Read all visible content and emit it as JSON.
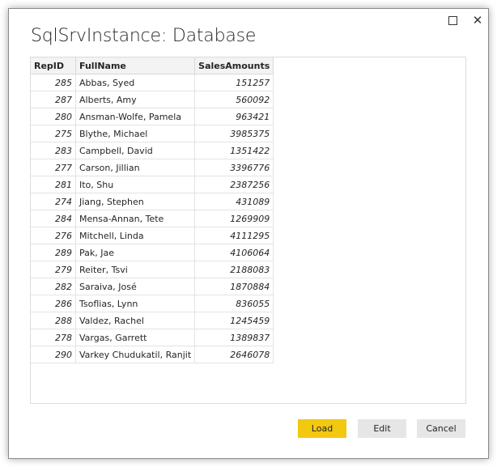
{
  "dialog": {
    "title": "SqlSrvInstance: Database",
    "maximize_icon": "maximize-icon",
    "close_icon": "close-icon",
    "close_glyph": "✕"
  },
  "table": {
    "columns": [
      "RepID",
      "FullName",
      "SalesAmounts"
    ],
    "rows": [
      {
        "repid": "285",
        "fullname": "Abbas, Syed",
        "sales": "151257"
      },
      {
        "repid": "287",
        "fullname": "Alberts, Amy",
        "sales": "560092"
      },
      {
        "repid": "280",
        "fullname": "Ansman-Wolfe, Pamela",
        "sales": "963421"
      },
      {
        "repid": "275",
        "fullname": "Blythe, Michael",
        "sales": "3985375"
      },
      {
        "repid": "283",
        "fullname": "Campbell, David",
        "sales": "1351422"
      },
      {
        "repid": "277",
        "fullname": "Carson, Jillian",
        "sales": "3396776"
      },
      {
        "repid": "281",
        "fullname": "Ito, Shu",
        "sales": "2387256"
      },
      {
        "repid": "274",
        "fullname": "Jiang, Stephen",
        "sales": "431089"
      },
      {
        "repid": "284",
        "fullname": "Mensa-Annan, Tete",
        "sales": "1269909"
      },
      {
        "repid": "276",
        "fullname": "Mitchell, Linda",
        "sales": "4111295"
      },
      {
        "repid": "289",
        "fullname": "Pak, Jae",
        "sales": "4106064"
      },
      {
        "repid": "279",
        "fullname": "Reiter, Tsvi",
        "sales": "2188083"
      },
      {
        "repid": "282",
        "fullname": "Saraiva, José",
        "sales": "1870884"
      },
      {
        "repid": "286",
        "fullname": "Tsoflias, Lynn",
        "sales": "836055"
      },
      {
        "repid": "288",
        "fullname": "Valdez, Rachel",
        "sales": "1245459"
      },
      {
        "repid": "278",
        "fullname": "Vargas, Garrett",
        "sales": "1389837"
      },
      {
        "repid": "290",
        "fullname": "Varkey Chudukatil, Ranjit",
        "sales": "2646078"
      }
    ]
  },
  "buttons": {
    "load": "Load",
    "edit": "Edit",
    "cancel": "Cancel"
  },
  "colors": {
    "load_button": "#f2c811",
    "secondary_button": "#e6e6e6"
  }
}
